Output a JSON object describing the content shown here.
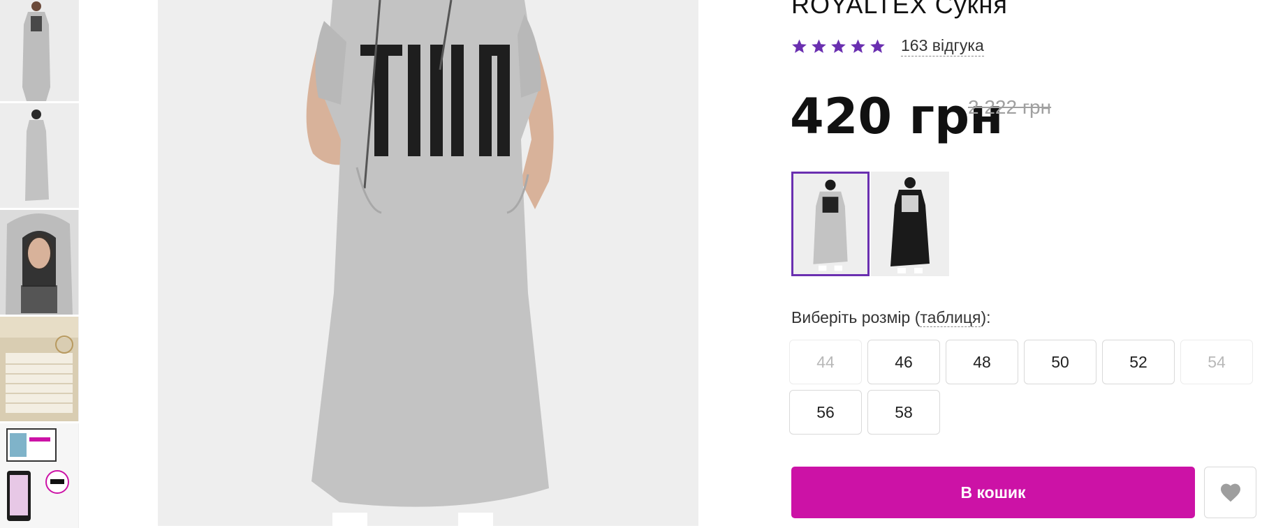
{
  "product": {
    "title": "ROYALTEX  Сукня",
    "rating": 5,
    "reviews_label": "163 відгука",
    "price": "420 грн",
    "old_price": "2 222 грн"
  },
  "thumbnails": [
    {
      "name": "thumb-dress-front"
    },
    {
      "name": "thumb-dress-side"
    },
    {
      "name": "thumb-hood-closeup"
    },
    {
      "name": "thumb-size-chart"
    },
    {
      "name": "thumb-how-to-order"
    }
  ],
  "main_image": {
    "alt": "Сукня"
  },
  "colors": [
    {
      "name": "grey",
      "hex": "#bdbdbd",
      "selected": true
    },
    {
      "name": "black",
      "hex": "#1a1a1a",
      "selected": false
    }
  ],
  "size_selector": {
    "label": "Виберіть розмір",
    "open_paren": "(",
    "table_link": "таблиця",
    "close_suffix": "):",
    "sizes": [
      {
        "label": "44",
        "available": false
      },
      {
        "label": "46",
        "available": true
      },
      {
        "label": "48",
        "available": true
      },
      {
        "label": "50",
        "available": true
      },
      {
        "label": "52",
        "available": true
      },
      {
        "label": "54",
        "available": false
      },
      {
        "label": "56",
        "available": true
      },
      {
        "label": "58",
        "available": true
      }
    ]
  },
  "actions": {
    "cart_label": "В кошик",
    "favorite_icon": "heart-icon"
  },
  "theme": {
    "accent": "#cc12a6",
    "star_color": "#6a2fb0",
    "selected_border": "#6a2fb0"
  }
}
